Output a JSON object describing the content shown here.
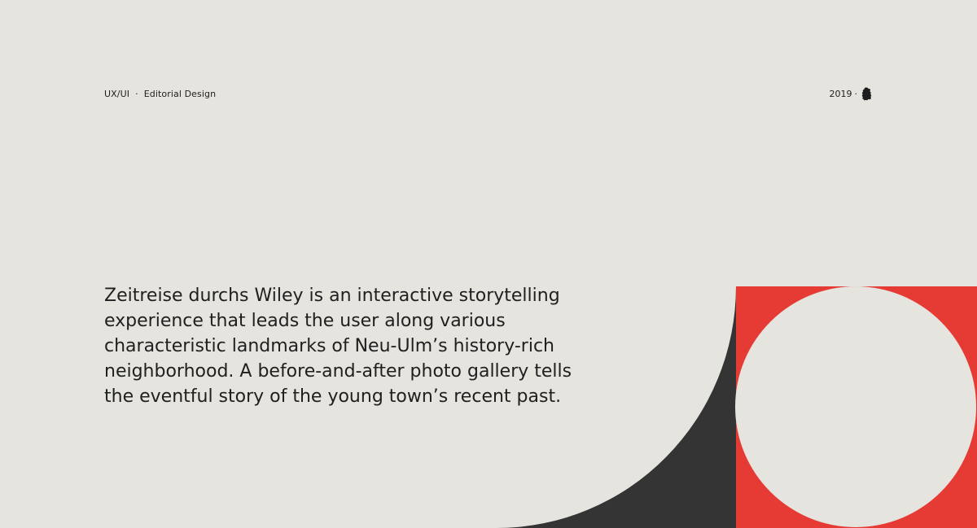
{
  "header": {
    "category_primary": "UX/UI",
    "separator": "·",
    "category_secondary": "Editorial Design",
    "year": "2019",
    "year_separator": "·",
    "location_icon": "germany-map-icon"
  },
  "main": {
    "description": "Zeitreise durchs Wiley is an interactive storytelling experience that leads the user along various characteristic landmarks of Neu-Ulm’s history-rich neighborhood. A before-and-after photo gallery tells the eventful story of the young town’s recent past."
  },
  "colors": {
    "background": "#e6e4df",
    "text": "#1f1f1f",
    "accent_red": "#e63a34",
    "dark_shape": "#343434"
  }
}
